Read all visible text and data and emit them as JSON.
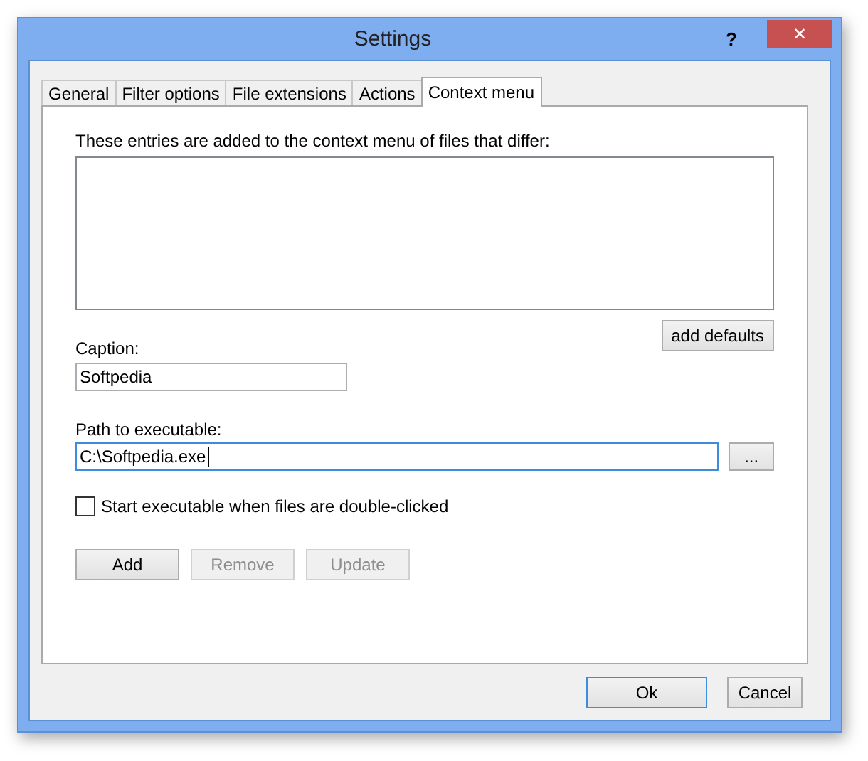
{
  "window": {
    "title": "Settings",
    "help": "?",
    "close": "✕"
  },
  "tabs": [
    {
      "label": "General",
      "selected": false
    },
    {
      "label": "Filter options",
      "selected": false
    },
    {
      "label": "File extensions",
      "selected": false
    },
    {
      "label": "Actions",
      "selected": false
    },
    {
      "label": "Context menu",
      "selected": true
    }
  ],
  "description": "These entries are added to the context menu of files that differ:",
  "add_defaults": "add defaults",
  "caption": {
    "label": "Caption:",
    "value": "Softpedia"
  },
  "path": {
    "label": "Path to executable:",
    "value": "C:\\Softpedia.exe",
    "focused": true,
    "browse": "..."
  },
  "start_on_double_click": {
    "label": "Start executable when files are double-clicked",
    "checked": false
  },
  "entry_buttons": [
    {
      "label": "Add",
      "disabled": false
    },
    {
      "label": "Remove",
      "disabled": true
    },
    {
      "label": "Update",
      "disabled": true
    }
  ],
  "dialog_buttons": [
    {
      "label": "Ok",
      "focused": true
    },
    {
      "label": "Cancel",
      "focused": false
    }
  ]
}
